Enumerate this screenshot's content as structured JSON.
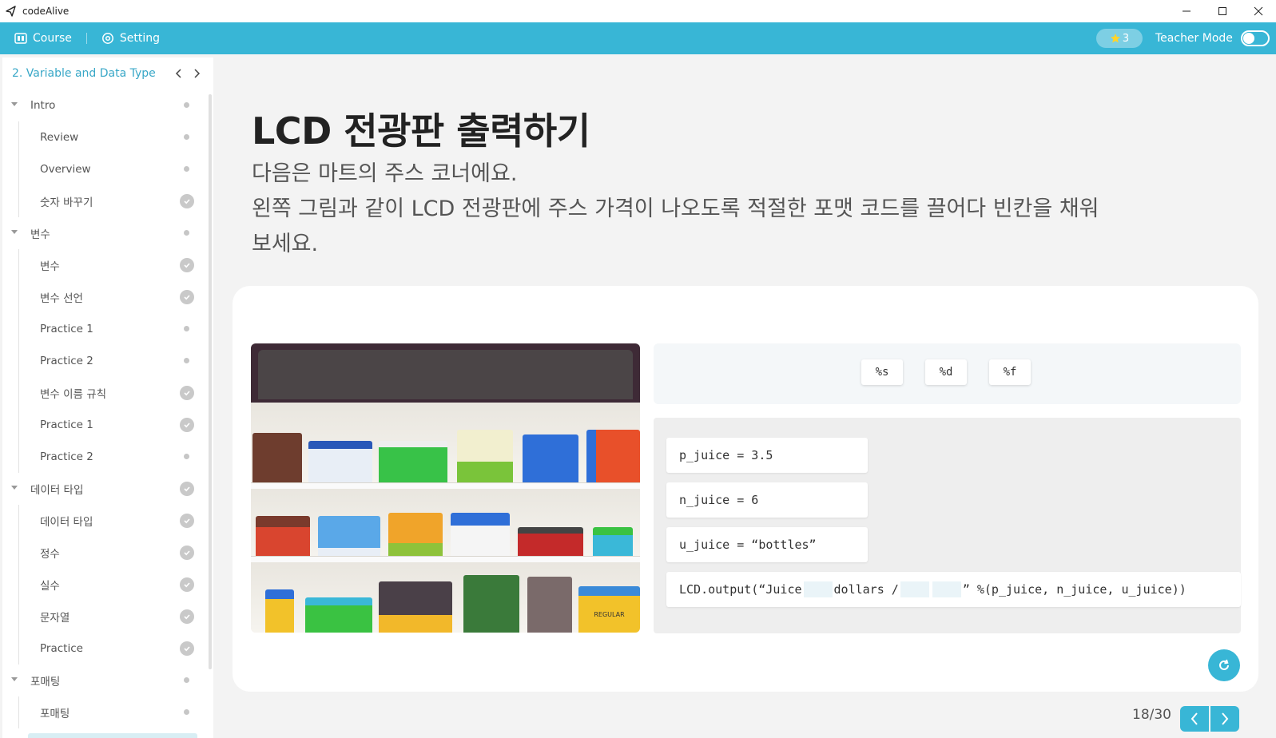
{
  "window": {
    "title": "codeAlive"
  },
  "topnav": {
    "course": "Course",
    "setting": "Setting",
    "stars": "3",
    "teacher_mode": "Teacher Mode",
    "teacher_mode_on": false
  },
  "sidebar": {
    "chapter": "2. Variable and Data Type",
    "items": [
      {
        "label": "Intro",
        "type": "section",
        "status": "dot"
      },
      {
        "label": "Review",
        "type": "child",
        "status": "dot"
      },
      {
        "label": "Overview",
        "type": "child",
        "status": "dot"
      },
      {
        "label": "숫자 바꾸기",
        "type": "child",
        "status": "check"
      },
      {
        "label": "변수",
        "type": "section",
        "status": "dot"
      },
      {
        "label": "변수",
        "type": "child",
        "status": "check"
      },
      {
        "label": "변수 선언",
        "type": "child",
        "status": "check"
      },
      {
        "label": "Practice 1",
        "type": "child",
        "status": "dot"
      },
      {
        "label": "Practice 2",
        "type": "child",
        "status": "dot"
      },
      {
        "label": "변수 이름 규칙",
        "type": "child",
        "status": "check"
      },
      {
        "label": "Practice 1",
        "type": "child",
        "status": "check"
      },
      {
        "label": "Practice 2",
        "type": "child",
        "status": "dot"
      },
      {
        "label": "데이터 타입",
        "type": "section",
        "status": "check"
      },
      {
        "label": "데이터 타입",
        "type": "child",
        "status": "check"
      },
      {
        "label": "정수",
        "type": "child",
        "status": "check"
      },
      {
        "label": "실수",
        "type": "child",
        "status": "check"
      },
      {
        "label": "문자열",
        "type": "child",
        "status": "check"
      },
      {
        "label": "Practice",
        "type": "child",
        "status": "check"
      },
      {
        "label": "포매팅",
        "type": "section",
        "status": "dot"
      },
      {
        "label": "포매팅",
        "type": "child",
        "status": "dot"
      }
    ]
  },
  "main": {
    "title": "LCD 전광판 출력하기",
    "desc_line1": "다음은 마트의 주스 코너에요.",
    "desc_line2": "왼쪽 그림과 같이 LCD 전광판에 주스 가격이 나오도록 적절한 포맷 코드를 끌어다 빈칸을 채워",
    "desc_line3": "보세요."
  },
  "exercise": {
    "shelf_label": "REGULAR",
    "options": [
      "%s",
      "%d",
      "%f"
    ],
    "code_lines": [
      "p_juice = 3.5",
      "n_juice = 6",
      "u_juice = “bottles”"
    ],
    "output_line": {
      "prefix": "LCD.output(“Juice",
      "middle": "dollars /",
      "suffix": "” %(p_juice, n_juice, u_juice))"
    }
  },
  "pager": {
    "current": "18/30"
  },
  "colors": {
    "accent": "#38b6d6",
    "sidebar_link": "#38a7c7"
  }
}
